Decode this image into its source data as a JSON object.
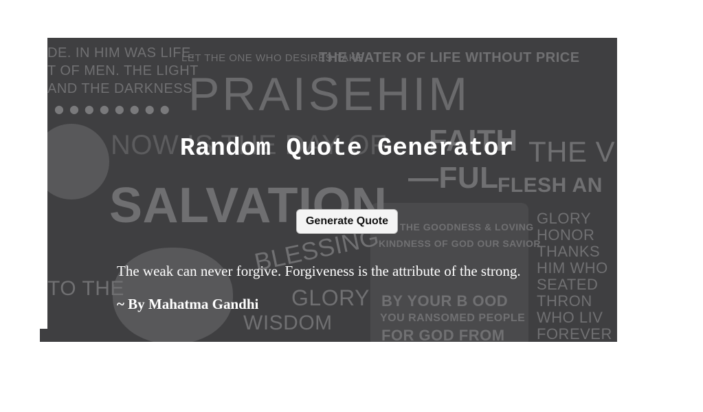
{
  "page": {
    "title": "Random Quote Generator",
    "button_label": "Generate Quote",
    "quote_text": "The weak can never forgive. Forgiveness is the attribute of the strong.",
    "author_text": "~ By Mahatma Gandhi"
  },
  "background_art": {
    "words": [
      "DE. IN HIM WAS LIFE,",
      "T OF MEN. THE LIGHT",
      "AND THE DARKNESS",
      "LET THE ONE WHO DESIRES TAKE",
      "THE WATER OF LIFE WITHOUT PRICE",
      "PRAISEHIM",
      "NOW IS THE DAY OF",
      "SALVATION",
      "FAITH",
      "—FUL",
      "THE V",
      "FLESH AN",
      "GLORY",
      "HONOR",
      "THANKS",
      "HIM WHO",
      "SEATED",
      "THRON",
      "WHO LIV",
      "FOREVER",
      "EN THE GOODNESS & LOVING",
      "KINDNESS OF GOD OUR SAVIOR",
      "BY YOUR B OOD",
      "YOU RANSOMED PEOPLE",
      "FOR GOD FROM",
      "BLESSING",
      "GLORY",
      "WISDOM",
      "TO THE"
    ]
  },
  "colors": {
    "card_background": "#3f3f41",
    "background_text": "#707072",
    "foreground_text": "#ffffff",
    "button_background": "#f4f4f4"
  }
}
